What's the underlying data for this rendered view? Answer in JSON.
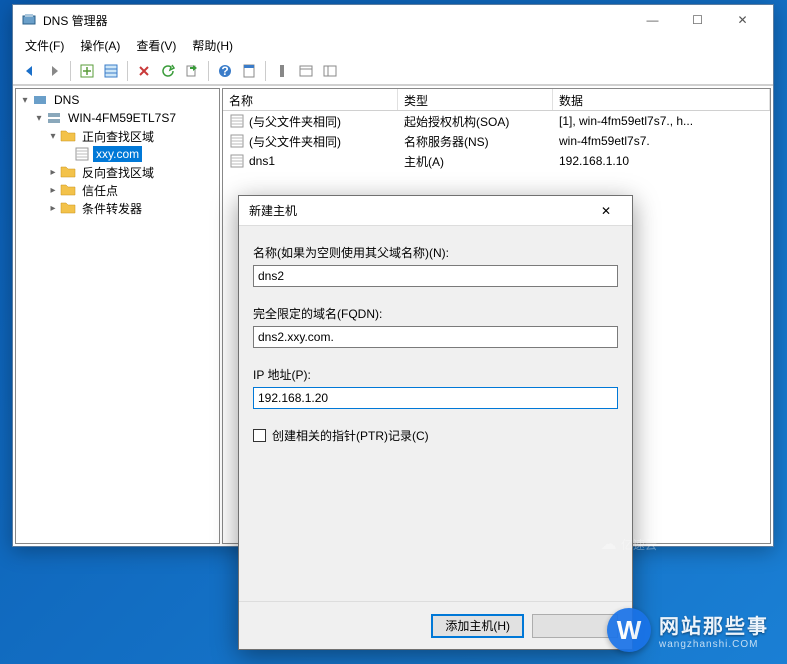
{
  "window": {
    "title": "DNS 管理器",
    "menus": [
      "文件(F)",
      "操作(A)",
      "查看(V)",
      "帮助(H)"
    ],
    "controls": {
      "min": "—",
      "max": "☐",
      "close": "✕"
    }
  },
  "tree": {
    "root": "DNS",
    "server": "WIN-4FM59ETL7S7",
    "forward": "正向查找区域",
    "zone": "xxy.com",
    "reverse": "反向查找区域",
    "trust": "信任点",
    "cond": "条件转发器"
  },
  "list": {
    "headers": {
      "name": "名称",
      "type": "类型",
      "data": "数据"
    },
    "rows": [
      {
        "name": "(与父文件夹相同)",
        "type": "起始授权机构(SOA)",
        "data": "[1], win-4fm59etl7s7., h..."
      },
      {
        "name": "(与父文件夹相同)",
        "type": "名称服务器(NS)",
        "data": "win-4fm59etl7s7."
      },
      {
        "name": "dns1",
        "type": "主机(A)",
        "data": "192.168.1.10"
      }
    ]
  },
  "dialog": {
    "title": "新建主机",
    "name_label": "名称(如果为空则使用其父域名称)(N):",
    "name_value": "dns2",
    "fqdn_label": "完全限定的域名(FQDN):",
    "fqdn_value": "dns2.xxy.com.",
    "ip_label": "IP 地址(P):",
    "ip_value": "192.168.1.20",
    "ptr_label": "创建相关的指针(PTR)记录(C)",
    "add_btn": "添加主机(H)",
    "close": "✕"
  },
  "watermark": {
    "badge": "W",
    "title": "网站那些事",
    "sub": "wangzhanshi.COM",
    "yun": "亿速云"
  }
}
